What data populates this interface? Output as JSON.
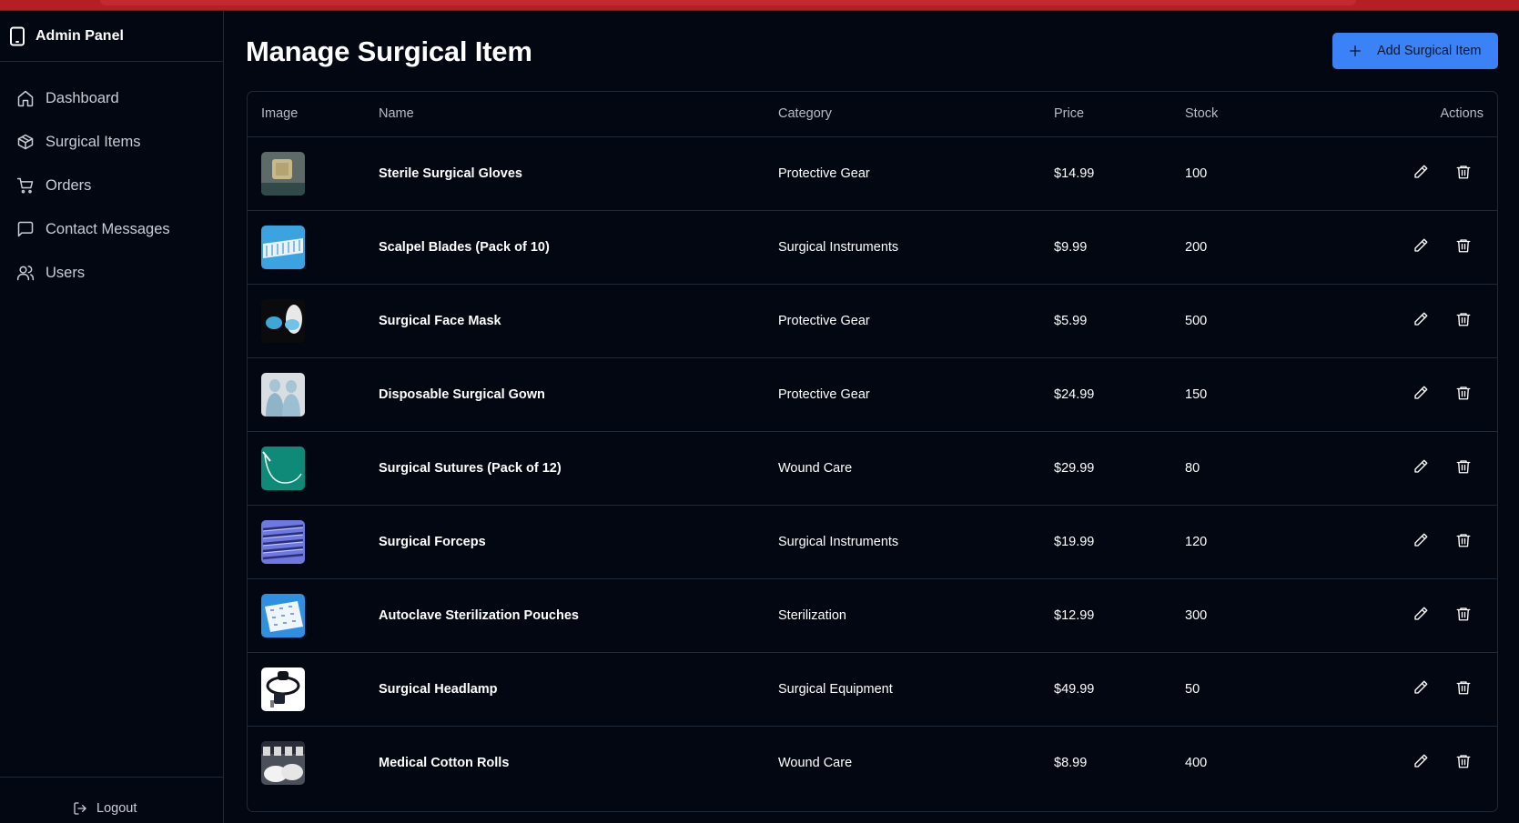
{
  "sidebar": {
    "brand": "Admin Panel",
    "items": [
      {
        "label": "Dashboard",
        "icon": "home-icon"
      },
      {
        "label": "Surgical Items",
        "icon": "package-icon"
      },
      {
        "label": "Orders",
        "icon": "cart-icon"
      },
      {
        "label": "Contact Messages",
        "icon": "message-icon"
      },
      {
        "label": "Users",
        "icon": "users-icon"
      }
    ],
    "logout_label": "Logout"
  },
  "main": {
    "title": "Manage Surgical Item",
    "add_button_label": "Add Surgical Item",
    "table": {
      "headers": [
        "Image",
        "Name",
        "Category",
        "Price",
        "Stock",
        "Actions"
      ],
      "rows": [
        {
          "name": "Sterile Surgical Gloves",
          "category": "Protective Gear",
          "price": "$14.99",
          "stock": "100"
        },
        {
          "name": "Scalpel Blades (Pack of 10)",
          "category": "Surgical Instruments",
          "price": "$9.99",
          "stock": "200"
        },
        {
          "name": "Surgical Face Mask",
          "category": "Protective Gear",
          "price": "$5.99",
          "stock": "500"
        },
        {
          "name": "Disposable Surgical Gown",
          "category": "Protective Gear",
          "price": "$24.99",
          "stock": "150"
        },
        {
          "name": "Surgical Sutures (Pack of 12)",
          "category": "Wound Care",
          "price": "$29.99",
          "stock": "80"
        },
        {
          "name": "Surgical Forceps",
          "category": "Surgical Instruments",
          "price": "$19.99",
          "stock": "120"
        },
        {
          "name": "Autoclave Sterilization Pouches",
          "category": "Sterilization",
          "price": "$12.99",
          "stock": "300"
        },
        {
          "name": "Surgical Headlamp",
          "category": "Surgical Equipment",
          "price": "$49.99",
          "stock": "50"
        },
        {
          "name": "Medical Cotton Rolls",
          "category": "Wound Care",
          "price": "$8.99",
          "stock": "400"
        }
      ]
    }
  },
  "colors": {
    "background": "#030712",
    "accent": "#3b82f6",
    "top_bar": "#b41f24",
    "border": "#1f2937"
  }
}
